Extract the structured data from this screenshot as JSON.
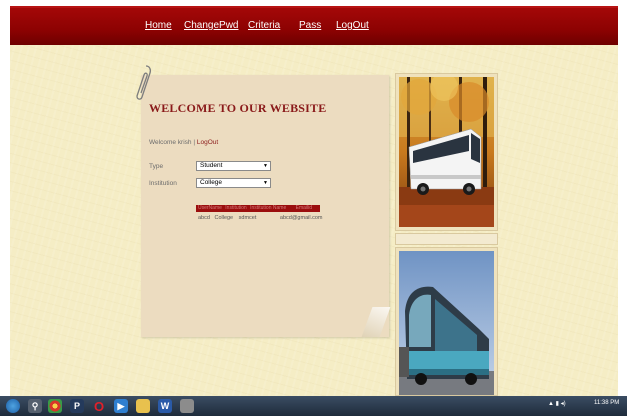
{
  "nav": {
    "items": [
      {
        "label": "Home"
      },
      {
        "label": "ChangePwd"
      },
      {
        "label": "Criteria"
      },
      {
        "label": "Pass"
      },
      {
        "label": "LogOut"
      }
    ]
  },
  "main": {
    "title": "WELCOME TO OUR WEBSITE",
    "welcome_text": "Welcome krish",
    "separator": "|",
    "logout_link": "LogOut",
    "form": {
      "type_label": "Type",
      "type_value": "Student",
      "institution_label": "Institution",
      "institution_value": "College"
    },
    "results": {
      "header": [
        "UserName",
        "Institution",
        "Institution Name",
        "Emailid"
      ],
      "row": [
        "abcd",
        "College",
        "sdmcet",
        "abcd@gmail.com"
      ]
    }
  },
  "taskbar": {
    "clock": "11:38 PM"
  },
  "colors": {
    "nav_background": "#8c0202",
    "page_background": "#f5edc5",
    "note_background": "#ecdcc0",
    "title_color": "#8a1a1a",
    "table_header": "#9b0e0e"
  },
  "icons": [
    "paperclip-icon",
    "chrome-icon",
    "search-icon",
    "photoshop-icon",
    "opera-icon",
    "folder-icon",
    "word-icon",
    "media-icon",
    "network-icon",
    "volume-icon"
  ]
}
